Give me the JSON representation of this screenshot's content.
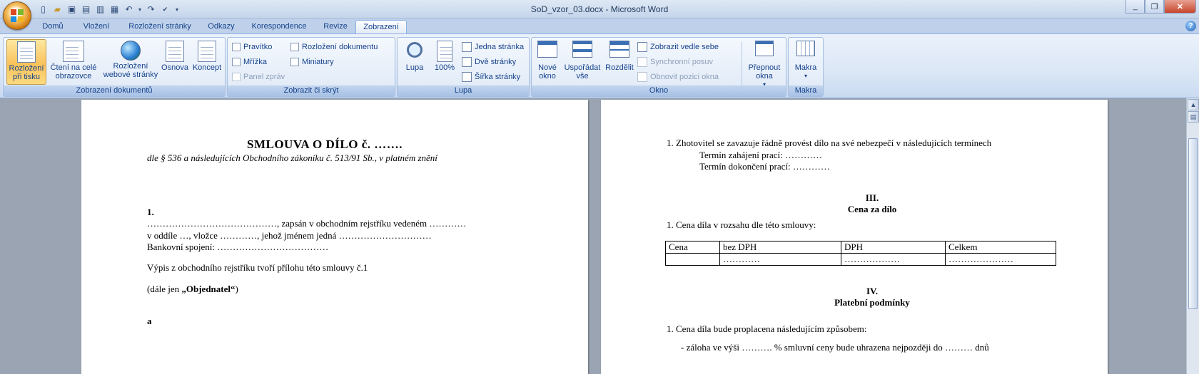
{
  "window": {
    "title": "SoD_vzor_03.docx - Microsoft Word",
    "controls": {
      "minimize": "_",
      "restore": "❐",
      "close": "✕"
    }
  },
  "qat": {
    "icons": [
      "new-icon",
      "open-icon",
      "save-icon",
      "print-preview-icon",
      "quick-print-icon",
      "print-icon",
      "undo-icon",
      "redo-icon",
      "spelling-icon",
      "customize-icon"
    ]
  },
  "tabs": [
    "Domů",
    "Vložení",
    "Rozložení stránky",
    "Odkazy",
    "Korespondence",
    "Revize",
    "Zobrazení"
  ],
  "active_tab": "Zobrazení",
  "help_glyph": "?",
  "ribbon": {
    "views": {
      "label": "Zobrazení dokumentů",
      "print_layout": "Rozložení při tisku",
      "full_screen": "Čtení na celé obrazovce",
      "web_layout": "Rozložení webové stránky",
      "outline": "Osnova",
      "draft": "Koncept"
    },
    "show_hide": {
      "label": "Zobrazit či skrýt",
      "ruler": "Pravítko",
      "gridlines": "Mřížka",
      "message_bar": "Panel zpráv",
      "doc_map": "Rozložení dokumentu",
      "thumbnails": "Miniatury"
    },
    "zoom": {
      "label": "Lupa",
      "zoom": "Lupa",
      "hundred": "100%",
      "one_page": "Jedna stránka",
      "two_pages": "Dvě stránky",
      "page_width": "Šířka stránky"
    },
    "window": {
      "label": "Okno",
      "new_window": "Nové okno",
      "arrange_all": "Uspořádat vše",
      "split": "Rozdělit",
      "side_by_side": "Zobrazit vedle sebe",
      "sync_scroll": "Synchronní posuv",
      "reset_pos": "Obnovit pozici okna",
      "switch": "Přepnout okna"
    },
    "macros": {
      "label": "Makra",
      "macros": "Makra"
    }
  },
  "page1": {
    "title": "SMLOUVA O DÍLO č. …….",
    "subtitle": "dle § 536 a následujících Obchodního zákoníku č. 513/91 Sb., v platném znění",
    "num": "1.",
    "line1": "……………………………………, zapsán v obchodním rejstříku vedeném …………",
    "line2": "v oddíle …, vložce …………, jehož jménem jedná …………………………",
    "line3": "Bankovní spojení: ………………………………",
    "line4": "Výpis z obchodního rejstříku tvoří přílohu této smlouvy č.1",
    "line5_pre": "(dále jen ",
    "line5_bold": "„Objednatel“",
    "line5_post": ")",
    "and": "a"
  },
  "page2": {
    "item1": "1.   Zhotovitel se zavazuje řádně provést dílo na své nebezpečí v následujících termínech",
    "start": "Termín zahájení prací: …………",
    "end": "Termín dokončení prací: …………",
    "sec3_num": "III.",
    "sec3_title": "Cena za dílo",
    "price_item": "1.   Cena díla v rozsahu dle této smlouvy:",
    "table": {
      "header": [
        "Cena",
        "bez DPH",
        "DPH",
        "Celkem"
      ],
      "row": [
        "",
        "…………",
        "………………",
        "…………………"
      ]
    },
    "sec4_num": "IV.",
    "sec4_title": "Platební podmínky",
    "pay_item": "1.   Cena díla bude proplacena následujícím způsobem:",
    "pay_dash": "-    záloha  ve výši  ………. % smluvní ceny bude uhrazena nejpozději do ……… dnů"
  }
}
